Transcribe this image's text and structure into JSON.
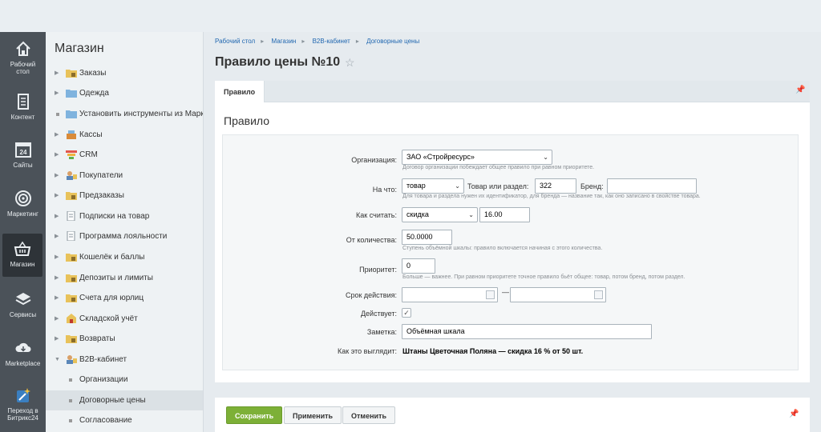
{
  "nav": [
    {
      "label1": "Рабочий",
      "label2": "стол",
      "icon": "home-icon"
    },
    {
      "label1": "Контент",
      "label2": "",
      "icon": "document-icon"
    },
    {
      "label1": "Сайты",
      "label2": "",
      "icon": "calendar-24-icon"
    },
    {
      "label1": "Маркетинг",
      "label2": "",
      "icon": "target-icon"
    },
    {
      "label1": "Магазин",
      "label2": "",
      "icon": "basket-icon"
    },
    {
      "label1": "Сервисы",
      "label2": "",
      "icon": "layers-icon"
    },
    {
      "label1": "Marketplace",
      "label2": "",
      "icon": "cloud-download-icon"
    },
    {
      "label1": "Переход в",
      "label2": "Битрикс24",
      "icon": "magic-wand-icon"
    }
  ],
  "menu": {
    "title": "Магазин",
    "items": [
      {
        "label": "Заказы"
      },
      {
        "label": "Одежда"
      },
      {
        "label": "Установить инструменты из Маркетплейс"
      },
      {
        "label": "Кассы"
      },
      {
        "label": "CRM"
      },
      {
        "label": "Покупатели"
      },
      {
        "label": "Предзаказы"
      },
      {
        "label": "Подписки на товар"
      },
      {
        "label": "Программа лояльности"
      },
      {
        "label": "Кошелёк и баллы"
      },
      {
        "label": "Депозиты и лимиты"
      },
      {
        "label": "Счета для юрлиц"
      },
      {
        "label": "Складской учёт"
      },
      {
        "label": "Возвраты"
      },
      {
        "label": "B2B-кабинет"
      },
      {
        "label": "Организации"
      },
      {
        "label": "Договорные цены"
      },
      {
        "label": "Согласование"
      }
    ]
  },
  "breadcrumb": [
    "Рабочий стол",
    "Магазин",
    "B2B-кабинет",
    "Договорные цены"
  ],
  "page_title": "Правило цены №10",
  "tab": "Правило",
  "card_title": "Правило",
  "form": {
    "org_label": "Организация:",
    "org_value": "ЗАО «Стройресурс»",
    "org_hint": "Договор организации побеждает общее правило при равном приоритете.",
    "target_label": "На что:",
    "target_value": "товар",
    "item_label": "Товар или раздел:",
    "item_value": "322",
    "brand_label": "Бренд:",
    "brand_value": "",
    "target_hint": "Для товара и раздела нужен их идентификатор, для бренда — название так, как оно записано в свойстве товара.",
    "calc_label": "Как считать:",
    "calc_value": "скидка",
    "calc_amount": "16.00",
    "qty_label": "От количества:",
    "qty_value": "50.0000",
    "qty_hint": "Ступень объёмной шкалы: правило включается начиная с этого количества.",
    "prio_label": "Приоритет:",
    "prio_value": "0",
    "prio_hint": "Больше — важнее. При равном приоритете точное правило бьёт общее: товар, потом бренд, потом раздел.",
    "period_label": "Срок действия:",
    "period_dash": "—",
    "active_label": "Действует:",
    "active_check": "✓",
    "note_label": "Заметка:",
    "note_value": "Объёмная шкала",
    "preview_label": "Как это выглядит:",
    "preview_value": "Штаны Цветочная Поляна — скидка 16 % от 50 шт."
  },
  "buttons": {
    "save": "Сохранить",
    "apply": "Применить",
    "cancel": "Отменить"
  }
}
